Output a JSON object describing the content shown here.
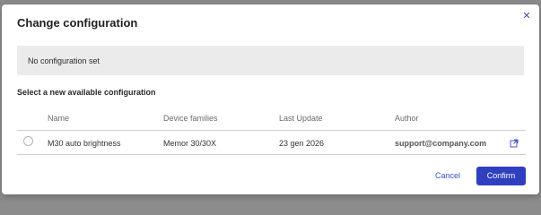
{
  "dialog": {
    "title": "Change configuration",
    "close_icon": "close-icon",
    "current_configuration": "No configuration set",
    "section_label": "Select a new available configuration"
  },
  "table": {
    "headers": {
      "name": "Name",
      "device_families": "Device families",
      "last_update": "Last Update",
      "author": "Author"
    },
    "rows": [
      {
        "selected": false,
        "name": "M30 auto brightness",
        "device_families": "Memor 30/30X",
        "last_update": "23 gen 2026",
        "author": "support@company.com",
        "action_icon": "external-link-icon"
      }
    ]
  },
  "footer": {
    "cancel_label": "Cancel",
    "confirm_label": "Confirm"
  },
  "colors": {
    "accent": "#2f3fc0",
    "link": "#3b4fc4",
    "current_box_bg": "#ebebeb",
    "backdrop": "#8c8c8c"
  }
}
